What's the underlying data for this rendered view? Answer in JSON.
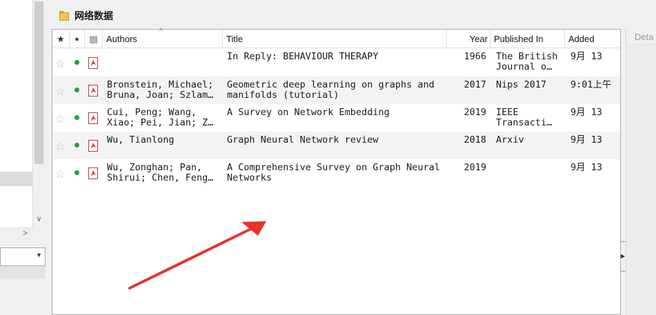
{
  "folder": {
    "title": "网络数据"
  },
  "columns": {
    "star": "★",
    "dot": "●",
    "attach": "▤",
    "authors": "Authors",
    "title": "Title",
    "year": "Year",
    "published_in": "Published In",
    "added": "Added"
  },
  "sort_indicator": "^",
  "rows": [
    {
      "authors": "",
      "title": "In Reply: BEHAVIOUR THERAPY",
      "year": "1966",
      "published_in": "The British\nJournal o…",
      "added": "9月 13"
    },
    {
      "authors": "Bronstein, Michael;\nBruna, Joan; Szlam…",
      "title": "Geometric deep learning on graphs and\nmanifolds (tutorial)",
      "year": "2017",
      "published_in": "Nips 2017",
      "added": "9:01上午"
    },
    {
      "authors": "Cui, Peng; Wang,\nXiao; Pei, Jian; Z…",
      "title": "A Survey on Network Embedding",
      "year": "2019",
      "published_in": "IEEE\nTransacti…",
      "added": "9月 13"
    },
    {
      "authors": "Wu, Tianlong",
      "title": "Graph Neural Network review",
      "year": "2018",
      "published_in": "Arxiv",
      "added": "9月 13"
    },
    {
      "authors": "Wu, Zonghan; Pan,\nShirui; Chen, Feng…",
      "title": "A Comprehensive Survey on Graph Neural\nNetworks",
      "year": "2019",
      "published_in": "",
      "added": "9月 13"
    }
  ],
  "icons": {
    "star": "☆",
    "read_status": "●",
    "attachment": "pdf-icon"
  },
  "right_panel": {
    "tab_label": "Deta"
  },
  "left_panel": {
    "scroll_down": "∨",
    "scroll_right": ">",
    "dropdown_arrow": "▼"
  },
  "colors": {
    "read_dot": "#21a336",
    "arrow": "#e8322a",
    "pdf": "#d23030"
  }
}
